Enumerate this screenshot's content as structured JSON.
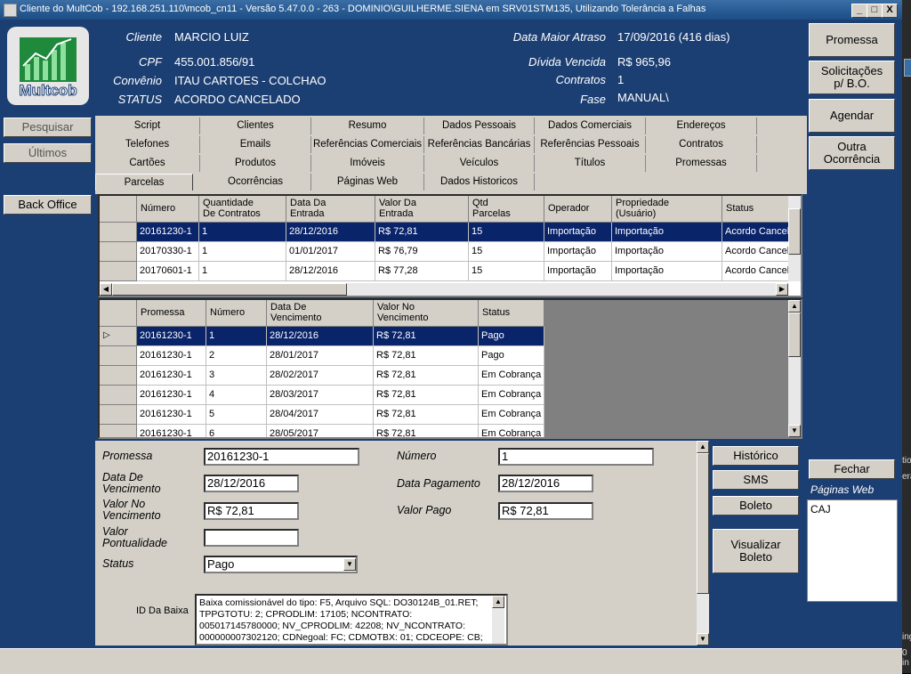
{
  "window": {
    "title": "Cliente do MultCob - 192.168.251.110\\mcob_cn11 - Versão 5.47.0.0 - 263 - DOMINIO\\GUILHERME.SIENA em SRV01STM135, Utilizando Tolerância a Falhas",
    "minimize": "_",
    "maximize": "□",
    "close": "X"
  },
  "logo": {
    "text": "Multcob"
  },
  "client": {
    "cliente_label": "Cliente",
    "cliente": "MARCIO LUIZ",
    "cpf_label": "CPF",
    "cpf": "455.001.856/91",
    "convenio_label": "Convênio",
    "convenio": "ITAU CARTOES - COLCHAO",
    "status_label": "STATUS",
    "status": "ACORDO CANCELADO",
    "data_maior_atraso_label": "Data Maior Atraso",
    "data_maior_atraso": "17/09/2016 (416 dias)",
    "divida_vencida_label": "Dívida Vencida",
    "divida_vencida": "R$ 965,96",
    "contratos_label": "Contratos",
    "contratos": "1",
    "fase_label": "Fase",
    "fase": "MANUAL\\"
  },
  "left_buttons": {
    "pesquisar": "Pesquisar",
    "ultimos": "Últimos",
    "back_office": "Back Office"
  },
  "right_buttons": {
    "promessa": "Promessa",
    "solicitacoes_1": "Solicitações",
    "solicitacoes_2": "p/ B.O.",
    "agendar": "Agendar",
    "outra_1": "Outra",
    "outra_2": "Ocorrência",
    "fechar": "Fechar",
    "paginas_web_label": "Páginas Web",
    "paginas_web_item": "CAJ"
  },
  "tabs": {
    "row1": [
      "Script",
      "Clientes",
      "Resumo",
      "Dados Pessoais",
      "Dados Comerciais",
      "Endereços"
    ],
    "row2": [
      "Telefones",
      "Emails",
      "Referências Comerciais",
      "Referências Bancárias",
      "Referências Pessoais",
      "Contratos"
    ],
    "row3": [
      "Cartões",
      "Produtos",
      "Imóveis",
      "Veículos",
      "Títulos",
      "Promessas"
    ],
    "row4": [
      "Parcelas",
      "Ocorrências",
      "Páginas Web",
      "Dados Historicos"
    ]
  },
  "grid1": {
    "headers": [
      "Número",
      "Quantidade\nDe Contratos",
      "Data Da\nEntrada",
      "Valor Da\nEntrada",
      "Qtd\nParcelas",
      "Operador",
      "Propriedade\n(Usuário)",
      "Status"
    ],
    "rows": [
      [
        "20161230-1",
        "1",
        "28/12/2016",
        "R$ 72,81",
        "15",
        "Importação",
        "Importação",
        "Acordo Cancel"
      ],
      [
        "20170330-1",
        "1",
        "01/01/2017",
        "R$ 76,79",
        "15",
        "Importação",
        "Importação",
        "Acordo Cancel"
      ],
      [
        "20170601-1",
        "1",
        "28/12/2016",
        "R$ 77,28",
        "15",
        "Importação",
        "Importação",
        "Acordo Cancel"
      ]
    ]
  },
  "grid2": {
    "headers": [
      "Promessa",
      "Número",
      "Data De\nVencimento",
      "Valor No\nVencimento",
      "Status"
    ],
    "rows": [
      [
        "20161230-1",
        "1",
        "28/12/2016",
        "R$ 72,81",
        "Pago"
      ],
      [
        "20161230-1",
        "2",
        "28/01/2017",
        "R$ 72,81",
        "Pago"
      ],
      [
        "20161230-1",
        "3",
        "28/02/2017",
        "R$ 72,81",
        "Em Cobrança"
      ],
      [
        "20161230-1",
        "4",
        "28/03/2017",
        "R$ 72,81",
        "Em Cobrança"
      ],
      [
        "20161230-1",
        "5",
        "28/04/2017",
        "R$ 72,81",
        "Em Cobrança"
      ],
      [
        "20161230-1",
        "6",
        "28/05/2017",
        "R$ 72,81",
        "Em Cobrança"
      ]
    ]
  },
  "form": {
    "promessa_label": "Promessa",
    "promessa": "20161230-1",
    "numero_label": "Número",
    "numero": "1",
    "data_venc_label_1": "Data De",
    "data_venc_label_2": "Vencimento",
    "data_venc": "28/12/2016",
    "data_pag_label": "Data Pagamento",
    "data_pag": "28/12/2016",
    "valor_venc_label_1": "Valor No",
    "valor_venc_label_2": "Vencimento",
    "valor_venc": "R$ 72,81",
    "valor_pago_label": "Valor Pago",
    "valor_pago": "R$ 72,81",
    "valor_pont_label_1": "Valor",
    "valor_pont_label_2": "Pontualidade",
    "valor_pont": "",
    "status_label": "Status",
    "status": "Pago",
    "id_baixa_label": "ID Da Baixa",
    "id_baixa": "Baixa comissionável do tipo: F5, Arquivo SQL: DO30124B_01.RET; TPPGTOTU: 2; CPRODLIM: 17105; NCONTRATO: 005017145780000; NV_CPRODLIM: 42208; NV_NCONTRATO: 000000007302120; CDNegoal: FC; CDMOTBX: 01; CDCEOPE: CB;",
    "historico": "Histórico",
    "sms": "SMS",
    "boleto": "Boleto",
    "visualizar_1": "Visualizar",
    "visualizar_2": "Boleto"
  },
  "edge_text": {
    "a": "tio",
    "b": "era",
    "c": "ing",
    "d": "0 in"
  }
}
